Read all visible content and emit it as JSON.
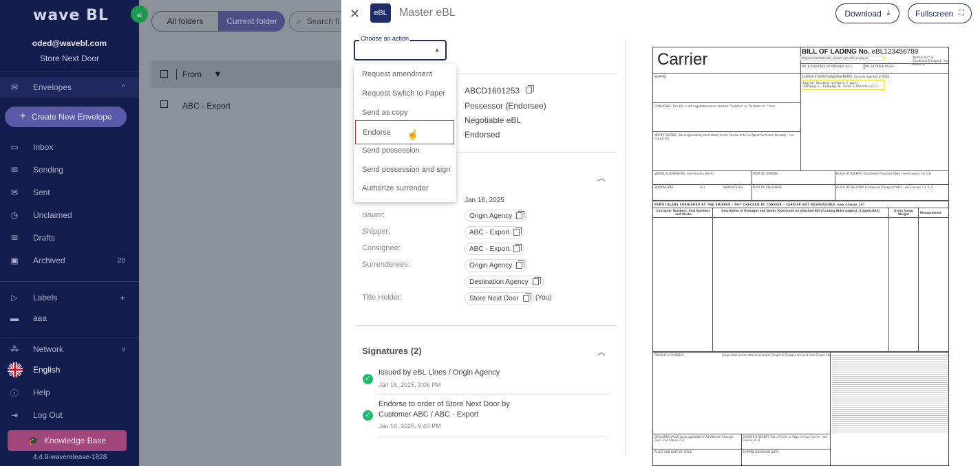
{
  "sidebar": {
    "logo": "wave BL",
    "collapse_icon": "«",
    "user_email": "oded@wavebl.com",
    "user_store": "Store Next Door",
    "envelopes": {
      "label": "Envelopes",
      "chevron": "^"
    },
    "create_label": "Create New Envelope",
    "items": [
      {
        "label": "Inbox",
        "icon": "inbox-icon"
      },
      {
        "label": "Sending",
        "icon": "sending-icon"
      },
      {
        "label": "Sent",
        "icon": "sent-icon"
      },
      {
        "label": "Unclaimed",
        "icon": "clock-icon"
      },
      {
        "label": "Drafts",
        "icon": "drafts-icon"
      },
      {
        "label": "Archived",
        "icon": "archive-icon",
        "count": "20"
      }
    ],
    "labels": {
      "label": "Labels",
      "add": "+"
    },
    "label_items": [
      {
        "label": "aaa"
      }
    ],
    "network": {
      "label": "Network",
      "chevron": "v"
    },
    "language": "English",
    "help": "Help",
    "logout": "Log Out",
    "kb": "Knowledge Base",
    "version": "4.4.9-waverelease-1828"
  },
  "main": {
    "folder_tabs": [
      "All folders",
      "Current folder"
    ],
    "search_placeholder": "Search fi",
    "table_header_from": "From",
    "row_from": "ABC - Export"
  },
  "panel": {
    "badge": "eBL",
    "title": "Master eBL",
    "download": "Download",
    "fullscreen": "Fullscreen",
    "action_label": "Choose an action",
    "actions": [
      "Request amendment",
      "Request Switch to Paper",
      "Send as copy",
      "Endorse",
      "Send possession",
      "Send possession and sign",
      "Authorize surrender"
    ],
    "summary": {
      "number": "ABCD1601253",
      "role": "Possessor (Endorsee)",
      "type": "Negotiable eBL",
      "status": "Endorsed"
    },
    "date": "Jan 16, 2025",
    "parties": {
      "issuer_label": "Issuer:",
      "issuer": "Origin Agency",
      "shipper_label": "Shipper:",
      "shipper": "ABC - Export",
      "consignee_label": "Consignee:",
      "consignee": "ABC - Export",
      "surrenderees_label": "Surrenderees:",
      "surrenderee_1": "Origin Agency",
      "surrenderee_2": "Destination Agency",
      "title_holder_label": "Title Holder:",
      "title_holder": "Store Next Door",
      "you": "(You)"
    },
    "signatures": {
      "title": "Signatures (2)",
      "items": [
        {
          "text": "Issued by eBL Lines / Origin Agency",
          "date": "Jan 16, 2025, 9:06 PM"
        },
        {
          "text": "Endorse to order of Store Next Door by",
          "text2": "Customer ABC / ABC - Export",
          "date": "Jan 16, 2025, 9:40 PM"
        }
      ]
    }
  },
  "document": {
    "carrier": "Carrier",
    "bol_title": "BILL OF LADING No.",
    "bol_number": "eBL123456789",
    "electronic_note": "Original electronically issued, not valid on paper",
    "port_note": "\"Port-to-Port\" or \"Combined Transport\" (see Clause 1)",
    "originals": "NO. & SEQUENCE OF ORIGINAL B/L's",
    "rider_pages": "NO. OF RIDER PAGES",
    "shipper": "SHIPPER:",
    "endorsements": "CARRIER'S AGENTS ENDORSEMENTS: (Include Agent(s) at POD)",
    "digital_note": "Digital Document contains 2 pages",
    "digital_pages": "[Rotpage-1, Ridepage-N, Terms & Conditions-1]",
    "consignee": "CONSIGNEE: This B/L is not negotiable unless marked \"To Order\" or \"To Order of...\" here.",
    "notify": "NOTIFY PARTIES: (No responsibility shall attach to the Carrier or to his Agent for failure to notify - see Clause 20)",
    "vessel": "VESSEL & VOYAGE NO. (see Clauses 8 & 9)",
    "port_loading": "PORT OF LOADING",
    "place_receipt": "PLACE OF RECEIPT: (Combined Transport ONLY - see Clauses 1 & 5.2)",
    "booking": "BOOKING REF.",
    "or": "(or)",
    "shippers_ref": "SHIPPER'S REF.",
    "port_discharge": "PORT OF DISCHARGE",
    "place_delivery": "PLACE OF DELIVERY: (Combined Transport ONLY - see Clauses 1 & 5.2)",
    "particulars": "PARTICULARS FURNISHED BY THE SHIPPER - NOT CHECKED BY CARRIER - CARRIER NOT RESPONSIBLE (see Clause 14)",
    "container": "Container Numbers, Seal Numbers and Marks",
    "description": "Description of Packages and Goods (Continued on attached Bill of Lading Rider page(s), if applicable)",
    "gross": "Gross Cargo Weight",
    "measurement": "Measurement",
    "freight": "FREIGHT & CHARGES",
    "freight_note": "Cargo shall not be delivered unless Freight & Charges are paid (see Clause 16).",
    "declared": "DECLARED VALUE (only applicable if Ad Valorem Charges paid - see Clause 7.3)",
    "carriers_receipt": "CARRIER'S RECEIPT (No. of Cntrs or Pkgs rcvd by Carrier - see Clause 14.1)",
    "place_issue": "PLACE AND DATE OF ISSUE",
    "shipped": "SHIPPED ON BOARD DATE"
  }
}
